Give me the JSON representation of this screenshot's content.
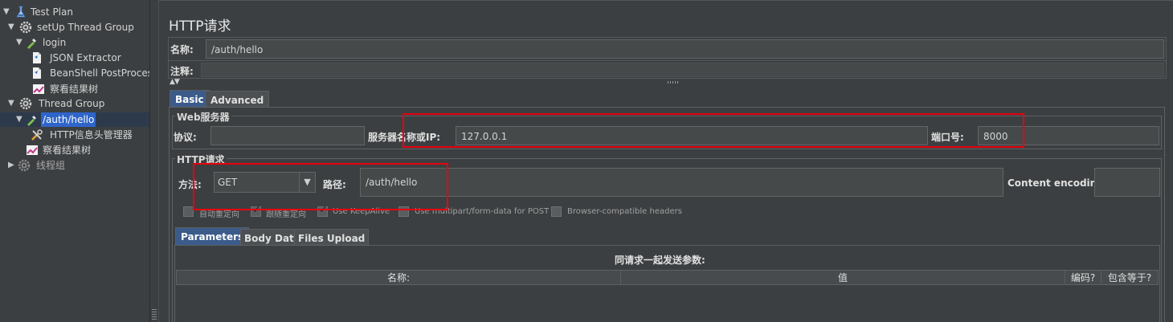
{
  "tree": {
    "items": [
      {
        "label": "Test Plan"
      },
      {
        "label": "setUp Thread Group"
      },
      {
        "label": "login"
      },
      {
        "label": "JSON Extractor"
      },
      {
        "label": "BeanShell PostProces"
      },
      {
        "label": "察看结果树"
      },
      {
        "label": "Thread  Group"
      },
      {
        "label": "/auth/hello"
      },
      {
        "label": "HTTP信息头管理器"
      },
      {
        "label": "察看结果树"
      },
      {
        "label": "线程组"
      }
    ]
  },
  "sampler": {
    "title": "HTTP请求",
    "name_label": "名称:",
    "name_value": "/auth/hello",
    "comment_label": "注释:",
    "comment_value": ""
  },
  "tabs": [
    {
      "label": "Basic"
    },
    {
      "label": "Advanced"
    }
  ],
  "web_server": {
    "title": "Web服务器",
    "protocol_label": "协议:",
    "protocol_value": "",
    "server_label": "服务器名称或IP:",
    "server_value": "127.0.0.1",
    "port_label": "端口号:",
    "port_value": "8000"
  },
  "http_request": {
    "title": "HTTP请求",
    "method_label": "方法:",
    "method_value": "GET",
    "path_label": "路径:",
    "path_value": "/auth/hello",
    "encoding_label": "Content encoding:",
    "encoding_value": ""
  },
  "options": [
    {
      "label": "自动重定向",
      "checked": false
    },
    {
      "label": "跟随重定向",
      "checked": true
    },
    {
      "label": "Use KeepAlive",
      "checked": true
    },
    {
      "label": "Use multipart/form-data for POST",
      "checked": false
    },
    {
      "label": "Browser-compatible headers",
      "checked": false
    }
  ],
  "param_tabs": [
    {
      "label": "Parameters"
    },
    {
      "label": "Body Data"
    },
    {
      "label": "Files Upload"
    }
  ],
  "params": {
    "caption": "同请求一起发送参数:",
    "columns": [
      "名称:",
      "值",
      "编码?",
      "包含等于?"
    ]
  },
  "colors": {
    "accent": "#3b5b8b",
    "selection": "#2f65ca",
    "highlight_box": "#e8000e"
  }
}
